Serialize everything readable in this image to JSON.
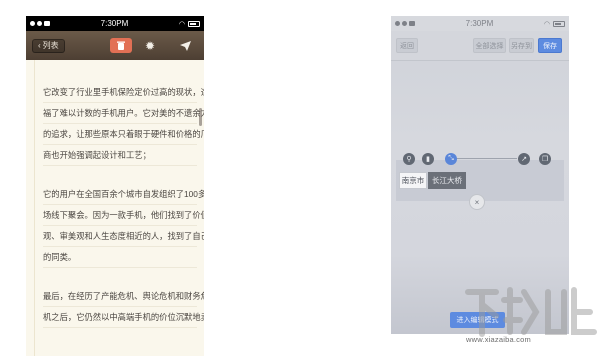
{
  "left_phone": {
    "status_bar": {
      "time": "7:30PM"
    },
    "toolbar": {
      "back_label": "列表"
    },
    "paragraphs": [
      [
        "它改变了行业里手机保险定价过高的现状，造",
        "福了难以计数的手机用户。它对美的不遗余力",
        "的追求，让那些原本只着眼于硬件和价格的厂",
        "商也开始强调起设计和工艺；"
      ],
      [
        "它的用户在全国百余个城市自发组织了100多",
        "场线下聚会。因为一款手机，他们找到了价值",
        "观、审美观和人生态度相近的人，找到了自己",
        "的同类。"
      ],
      [
        "最后，在经历了产能危机、舆论危机和财务危",
        "机之后，它仍然以中高端手机的价位沉默地卖"
      ]
    ]
  },
  "right_phone": {
    "status_bar": {
      "time": "7:30PM"
    },
    "toolbar": {
      "return_label": "返回",
      "select_all_label": "全部选择",
      "save_as_label": "另存到",
      "save_label": "保存"
    },
    "chips": {
      "first": "南京市",
      "second": "长江大桥"
    },
    "close_label": "×",
    "enter_edit_label": "进入编辑模式"
  },
  "watermark": {
    "text": "www.xiazaiba.com",
    "logo_text": "下载吧"
  },
  "colors": {
    "toolbar_brown": "#5b4b3d",
    "delete_red": "#e27055",
    "accent_blue": "#5d8be0",
    "paper": "#faf7ec"
  },
  "icons": {
    "left_toolbar": [
      "back-arrow-icon",
      "trash-icon",
      "gear-icon",
      "send-icon"
    ],
    "right_edit": [
      "search-icon",
      "delete-icon",
      "connect-icon",
      "share-icon",
      "copy-icon"
    ]
  }
}
